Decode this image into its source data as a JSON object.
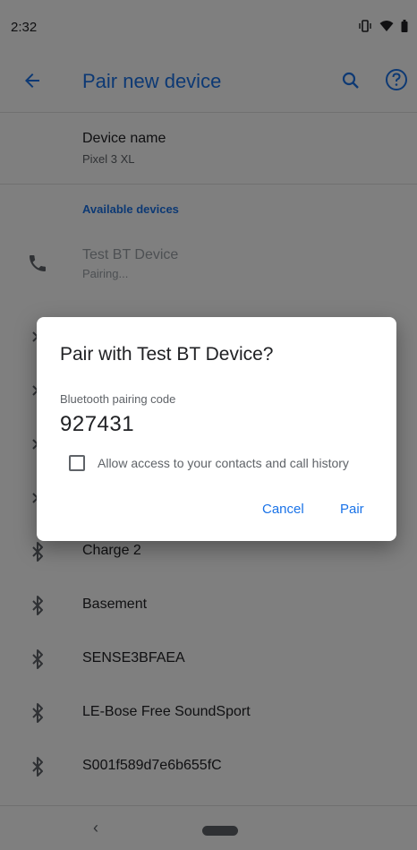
{
  "status_bar": {
    "time": "2:32",
    "icons": [
      "vibrate-icon",
      "wifi-icon",
      "battery-icon"
    ]
  },
  "app_bar": {
    "title": "Pair new device",
    "icons": [
      "back-arrow-icon",
      "search-icon",
      "help-icon"
    ]
  },
  "device_name": {
    "label": "Device name",
    "value": "Pixel 3 XL"
  },
  "available_header": "Available devices",
  "devices": [
    {
      "name": "Test BT Device",
      "status": "Pairing...",
      "icon": "phone-icon"
    },
    {
      "name": "Charge 2",
      "icon": "bluetooth-icon"
    },
    {
      "name": "Basement",
      "icon": "bluetooth-icon"
    },
    {
      "name": "SENSE3BFAEA",
      "icon": "bluetooth-icon"
    },
    {
      "name": "LE-Bose Free SoundSport",
      "icon": "bluetooth-icon"
    },
    {
      "name": "S001f589d7e6b655fC",
      "icon": "bluetooth-icon"
    }
  ],
  "dialog": {
    "title": "Pair with Test BT Device?",
    "code_label": "Bluetooth pairing code",
    "code": "927431",
    "checkbox_label": "Allow access to your contacts and call history",
    "checkbox_checked": false,
    "cancel_label": "Cancel",
    "pair_label": "Pair"
  },
  "nav_bar": {
    "back_glyph": "‹"
  },
  "colors": {
    "accent": "#1a73e8",
    "scrim": "rgba(0,0,0,0.5)"
  }
}
